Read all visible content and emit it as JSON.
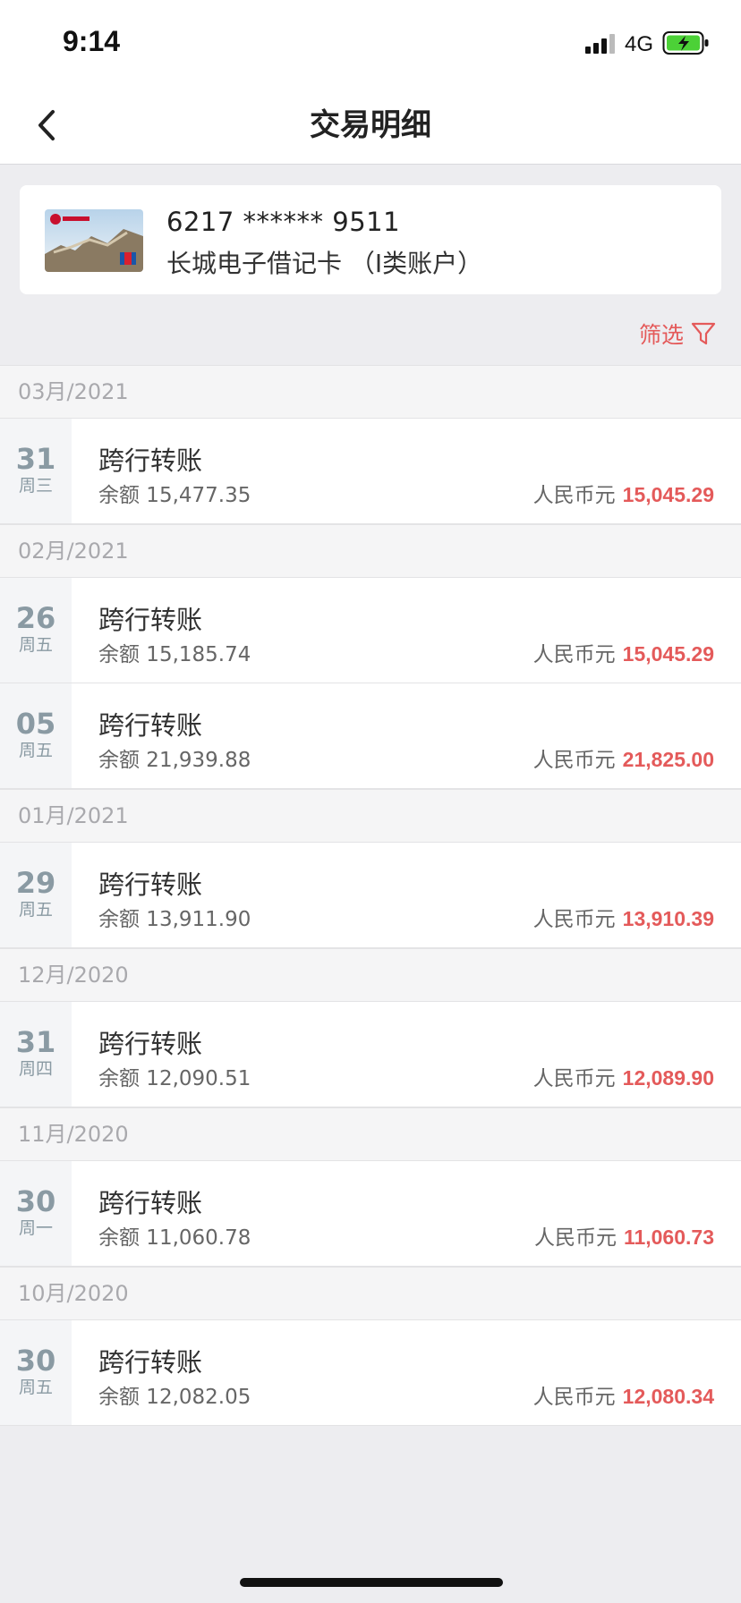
{
  "status_bar": {
    "time": "9:14",
    "network": "4G"
  },
  "nav": {
    "title": "交易明细"
  },
  "card": {
    "number": "6217 ****** 9511",
    "name": "长城电子借记卡  （I类账户）"
  },
  "filter": {
    "label": "筛选"
  },
  "colors": {
    "accent_red": "#e45a5a",
    "date_gray": "#8a9aa3",
    "background": "#ededf0"
  },
  "groups": [
    {
      "month": "03月/2021",
      "transactions": [
        {
          "day": "31",
          "weekday": "周三",
          "type": "跨行转账",
          "balance": "余额 15,477.35",
          "currency": "人民币元",
          "amount": "15,045.29"
        }
      ]
    },
    {
      "month": "02月/2021",
      "transactions": [
        {
          "day": "26",
          "weekday": "周五",
          "type": "跨行转账",
          "balance": "余额 15,185.74",
          "currency": "人民币元",
          "amount": "15,045.29"
        },
        {
          "day": "05",
          "weekday": "周五",
          "type": "跨行转账",
          "balance": "余额 21,939.88",
          "currency": "人民币元",
          "amount": "21,825.00"
        }
      ]
    },
    {
      "month": "01月/2021",
      "transactions": [
        {
          "day": "29",
          "weekday": "周五",
          "type": "跨行转账",
          "balance": "余额 13,911.90",
          "currency": "人民币元",
          "amount": "13,910.39"
        }
      ]
    },
    {
      "month": "12月/2020",
      "transactions": [
        {
          "day": "31",
          "weekday": "周四",
          "type": "跨行转账",
          "balance": "余额 12,090.51",
          "currency": "人民币元",
          "amount": "12,089.90"
        }
      ]
    },
    {
      "month": "11月/2020",
      "transactions": [
        {
          "day": "30",
          "weekday": "周一",
          "type": "跨行转账",
          "balance": "余额 11,060.78",
          "currency": "人民币元",
          "amount": "11,060.73"
        }
      ]
    },
    {
      "month": "10月/2020",
      "transactions": [
        {
          "day": "30",
          "weekday": "周五",
          "type": "跨行转账",
          "balance": "余额 12,082.05",
          "currency": "人民币元",
          "amount": "12,080.34"
        }
      ]
    }
  ]
}
